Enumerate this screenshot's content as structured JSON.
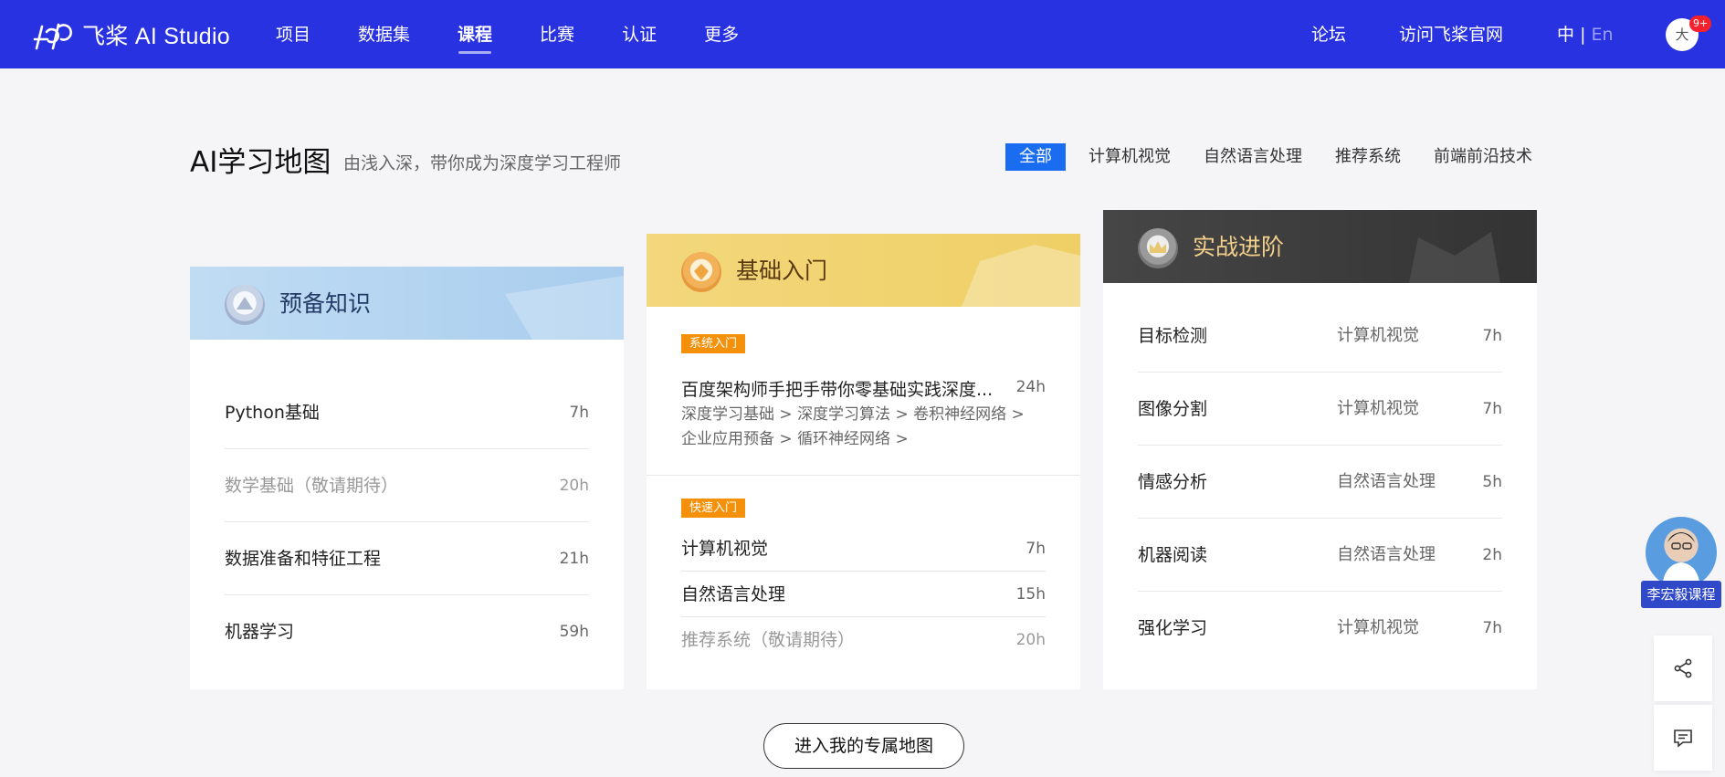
{
  "header": {
    "logo_text": "飞桨 AI Studio",
    "nav": [
      "项目",
      "数据集",
      "课程",
      "比赛",
      "认证",
      "更多"
    ],
    "active_nav": "课程",
    "forum": "论坛",
    "official_site": "访问飞桨官网",
    "lang_zh": "中",
    "lang_sep": "|",
    "lang_en": "En",
    "avatar_text": "大",
    "badge": "9+"
  },
  "page": {
    "title": "AI学习地图",
    "subtitle": "由浅入深，带你成为深度学习工程师",
    "filters": [
      "全部",
      "计算机视觉",
      "自然语言处理",
      "推荐系统",
      "前端前沿技术"
    ],
    "active_filter": "全部",
    "cta": "进入我的专属地图"
  },
  "card1": {
    "title": "预备知识",
    "rows": [
      {
        "name": "Python基础",
        "hours": "7h",
        "dim": false
      },
      {
        "name": "数学基础（敬请期待）",
        "hours": "20h",
        "dim": true
      },
      {
        "name": "数据准备和特征工程",
        "hours": "21h",
        "dim": false
      },
      {
        "name": "机器学习",
        "hours": "59h",
        "dim": false
      }
    ]
  },
  "card2": {
    "title": "基础入门",
    "section1": {
      "tag": "系统入门",
      "course": "百度架构师手把手带你零基础实践深度...",
      "hours": "24h",
      "path_line1": [
        "深度学习基础 >",
        "深度学习算法 >",
        "卷积神经网络 >"
      ],
      "path_line2": [
        "企业应用预备 >",
        "循环神经网络 >"
      ]
    },
    "section2": {
      "tag": "快速入门",
      "rows": [
        {
          "name": "计算机视觉",
          "hours": "7h",
          "dim": false
        },
        {
          "name": "自然语言处理",
          "hours": "15h",
          "dim": false
        },
        {
          "name": "推荐系统（敬请期待）",
          "hours": "20h",
          "dim": true
        }
      ]
    }
  },
  "card3": {
    "title": "实战进阶",
    "rows": [
      {
        "name": "目标检测",
        "tag": "计算机视觉",
        "hours": "7h"
      },
      {
        "name": "图像分割",
        "tag": "计算机视觉",
        "hours": "7h"
      },
      {
        "name": "情感分析",
        "tag": "自然语言处理",
        "hours": "5h"
      },
      {
        "name": "机器阅读",
        "tag": "自然语言处理",
        "hours": "2h"
      },
      {
        "name": "强化学习",
        "tag": "计算机视觉",
        "hours": "7h"
      }
    ]
  },
  "side": {
    "teacher_label": "李宏毅课程",
    "icons": [
      "share-icon",
      "feedback-icon"
    ]
  },
  "colors": {
    "header_bg": "#2932e1",
    "filter_active": "#1a6cf0",
    "tag_orange": "#f5900b",
    "card1_head": "#b6d5f0",
    "card2_head": "#f3d676",
    "card3_head": "#3a3a3a",
    "teacher_label_bg": "#2f49c9"
  }
}
